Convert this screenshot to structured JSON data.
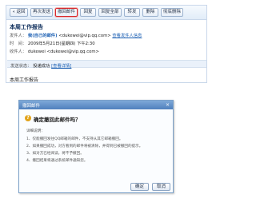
{
  "toolbar": {
    "buttons": [
      "« 返回",
      "再次发送",
      "撤回邮件",
      "回复",
      "回复全部",
      "转发",
      "删除",
      "彻底删除"
    ]
  },
  "mail": {
    "subject": "本周工作报告",
    "from_label": "发件人：",
    "from_name": "我(自己的邮件)",
    "from_email": "<dukewei@vip.qq.com>",
    "from_link": "查看发件人信息",
    "time_label": "时　间：",
    "time_value": "2009年5月21日(星期四) 下午2:30",
    "to_label": "收件人：",
    "to_value": "dukewei",
    "to_email": "<dukewei@vip.qq.com>",
    "status_label": "发送状态：",
    "status_value": "投递成功",
    "status_link": "[查看详情]",
    "body": "本周工作报告"
  },
  "dialog": {
    "title": "撤回邮件",
    "close_glyph": "×",
    "question": "确定撤回此邮件吗？",
    "notes_title": "详细说明：",
    "notes": [
      "1、仅能撤回发往QQ邮箱的邮件，不支持从其它邮箱撤回。",
      "2、如果撤回成功，对方看到的邮件将被清除，并得到已被撤回的提示。",
      "3、如对方已经阅读，将不予撤回。",
      "4、撤回结果将通过系统邮件通知您。"
    ],
    "ok_label": "确定",
    "cancel_label": "取消"
  }
}
